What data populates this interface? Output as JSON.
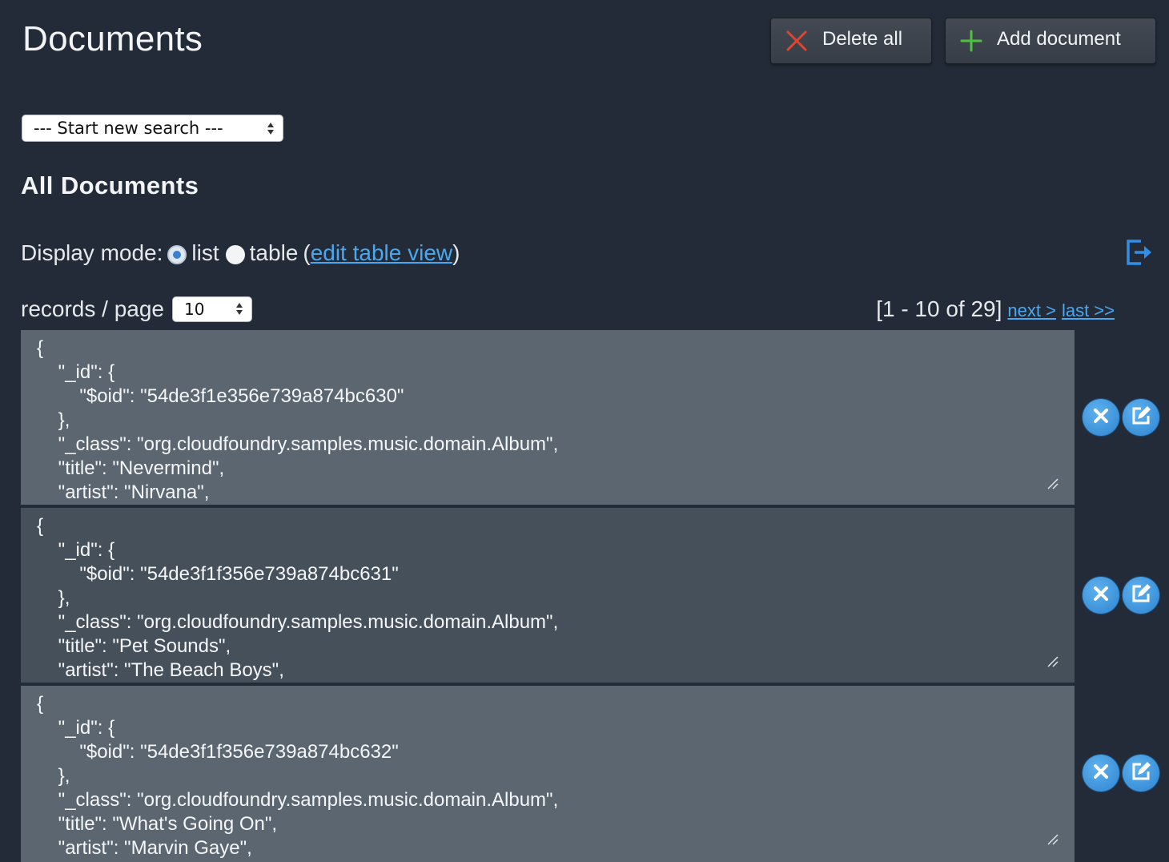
{
  "header": {
    "title": "Documents",
    "delete_all_label": "Delete all",
    "add_document_label": "Add document"
  },
  "search": {
    "selected": "--- Start new search ---"
  },
  "section": {
    "title": "All Documents"
  },
  "display_mode": {
    "label": "Display mode:",
    "options": [
      "list",
      "table"
    ],
    "selected": "list",
    "paren_open": "(",
    "edit_table_view_label": "edit table view",
    "paren_close": ")"
  },
  "pagination": {
    "records_label": "records / page",
    "records_per_page": "10",
    "range_text": "[1 - 10 of 29]",
    "next_label": "next >",
    "last_label": "last >>"
  },
  "documents": [
    {
      "text": "{\n    \"_id\": {\n        \"$oid\": \"54de3f1e356e739a874bc630\"\n    },\n    \"_class\": \"org.cloudfoundry.samples.music.domain.Album\",\n    \"title\": \"Nevermind\",\n    \"artist\": \"Nirvana\","
    },
    {
      "text": "{\n    \"_id\": {\n        \"$oid\": \"54de3f1f356e739a874bc631\"\n    },\n    \"_class\": \"org.cloudfoundry.samples.music.domain.Album\",\n    \"title\": \"Pet Sounds\",\n    \"artist\": \"The Beach Boys\","
    },
    {
      "text": "{\n    \"_id\": {\n        \"$oid\": \"54de3f1f356e739a874bc632\"\n    },\n    \"_class\": \"org.cloudfoundry.samples.music.domain.Album\",\n    \"title\": \"What's Going On\",\n    \"artist\": \"Marvin Gaye\","
    }
  ],
  "icons": {
    "delete_all": "x-icon",
    "add_document": "plus-icon",
    "export": "export-icon",
    "delete_doc": "x-circle-icon",
    "edit_doc": "edit-icon"
  },
  "colors": {
    "background": "#222b37",
    "doc_light": "#5b6670",
    "doc_dark": "#46505b",
    "link": "#4aa8f0",
    "delete_red": "#e0452f",
    "add_green": "#4cc23e",
    "action_blue": "#3b93de"
  }
}
